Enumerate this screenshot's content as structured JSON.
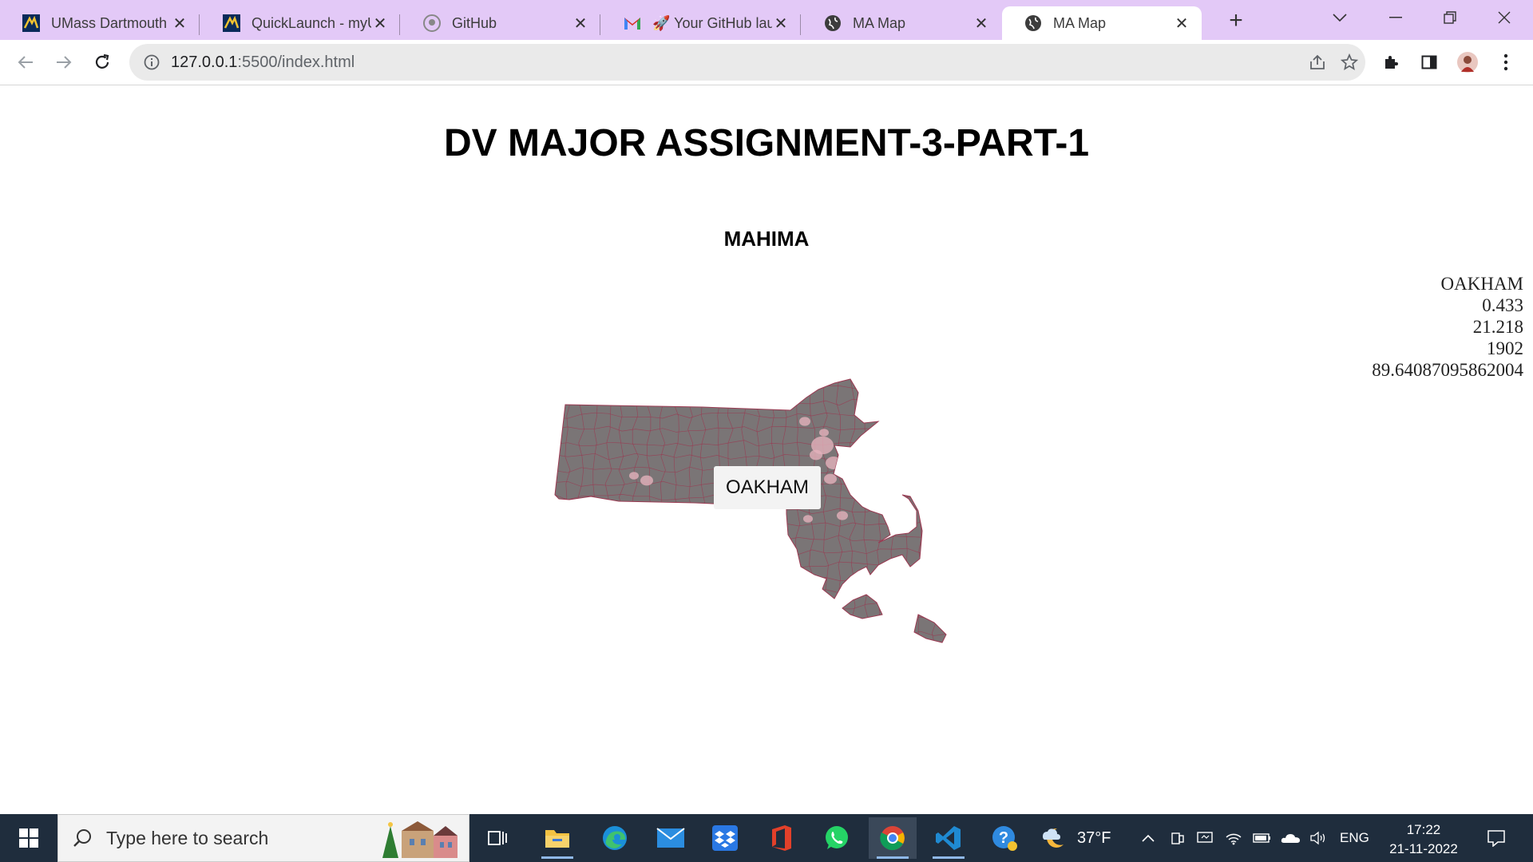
{
  "browser": {
    "tabs": [
      {
        "title": "UMass Dartmouth",
        "icon": "umass-logo-icon",
        "active": false
      },
      {
        "title": "QuickLaunch - myUMassD",
        "icon": "umass-logo-icon",
        "active": false
      },
      {
        "title": "GitHub",
        "icon": "github-icon",
        "active": false
      },
      {
        "title": "🚀 Your GitHub launch",
        "icon": "gmail-icon",
        "active": false
      },
      {
        "title": "MA Map",
        "icon": "globe-icon",
        "active": false
      },
      {
        "title": "MA Map",
        "icon": "globe-icon",
        "active": true
      }
    ],
    "url_host": "127.0.0.1",
    "url_rest": ":5500/index.html"
  },
  "page": {
    "title": "DV MAJOR ASSIGNMENT-3-PART-1",
    "author": "MAHIMA",
    "tooltip": "OAKHAM",
    "info_lines": [
      "OAKHAM",
      "0.433",
      "21.218",
      "1902",
      "89.64087095862004"
    ]
  },
  "map": {
    "fill_color": "#7a7576",
    "border_color": "#9a3a52",
    "highlight_color": "#e3b1bc"
  },
  "taskbar": {
    "search_placeholder": "Type here to search",
    "weather_temp": "37°F",
    "language": "ENG",
    "time": "17:22",
    "date": "21-11-2022"
  }
}
